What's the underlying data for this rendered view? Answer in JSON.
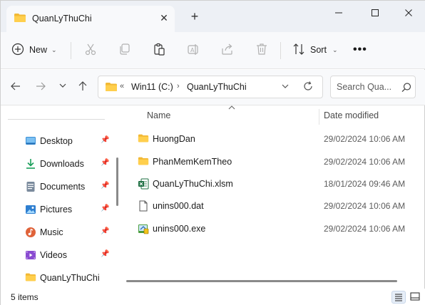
{
  "tab": {
    "title": "QuanLyThuChi",
    "close_glyph": "✕",
    "new_tab_glyph": "+"
  },
  "window_controls": {
    "minimize": "—",
    "maximize": "☐",
    "close": "✕"
  },
  "toolbar": {
    "new_label": "New",
    "sort_label": "Sort",
    "more_glyph": "•••",
    "icons": [
      "plus-circle-icon",
      "cut-icon",
      "copy-icon",
      "paste-icon",
      "rename-icon",
      "share-icon",
      "delete-icon",
      "sort-icon"
    ]
  },
  "address": {
    "overflow": "«",
    "crumbs": [
      "Win11 (C:)",
      "QuanLyThuChi"
    ],
    "separator": "›"
  },
  "search": {
    "placeholder": "Search Qua..."
  },
  "sidebar": {
    "items": [
      {
        "label": "Desktop",
        "icon": "desktop-icon",
        "pinned": true
      },
      {
        "label": "Downloads",
        "icon": "download-icon",
        "pinned": true
      },
      {
        "label": "Documents",
        "icon": "documents-icon",
        "pinned": true
      },
      {
        "label": "Pictures",
        "icon": "pictures-icon",
        "pinned": true
      },
      {
        "label": "Music",
        "icon": "music-icon",
        "pinned": true
      },
      {
        "label": "Videos",
        "icon": "videos-icon",
        "pinned": true
      },
      {
        "label": "QuanLyThuChi",
        "icon": "folder-icon",
        "pinned": false
      }
    ]
  },
  "columns": {
    "name": "Name",
    "date_modified": "Date modified"
  },
  "files": [
    {
      "name": "HuongDan",
      "date": "29/02/2024 10:06 AM",
      "type": "folder"
    },
    {
      "name": "PhanMemKemTheo",
      "date": "29/02/2024 10:06 AM",
      "type": "folder"
    },
    {
      "name": "QuanLyThuChi.xlsm",
      "date": "18/01/2024 09:46 AM",
      "type": "excel"
    },
    {
      "name": "unins000.dat",
      "date": "29/02/2024 10:06 AM",
      "type": "file"
    },
    {
      "name": "unins000.exe",
      "date": "29/02/2024 10:06 AM",
      "type": "exe"
    }
  ],
  "status": {
    "item_count": "5 items"
  },
  "colors": {
    "folder": "#f2b935",
    "accent": "#0067c0",
    "excel": "#1d6f42"
  }
}
